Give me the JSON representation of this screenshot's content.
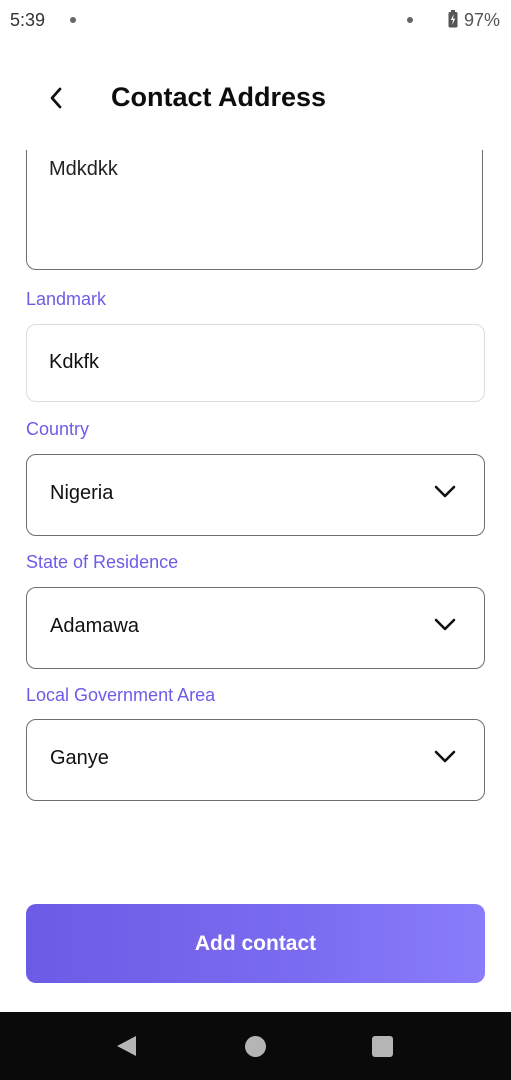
{
  "status_bar": {
    "time": "5:39",
    "battery": "97%"
  },
  "header": {
    "title": "Contact Address",
    "back_icon": "chevron-left-icon"
  },
  "form": {
    "address_value": "Mdkdkk",
    "landmark_label": "Landmark",
    "landmark_value": "Kdkfk",
    "country_label": "Country",
    "country_value": "Nigeria",
    "state_label": "State of Residence",
    "state_value": "Adamawa",
    "lga_label": "Local Government Area",
    "lga_value": "Ganye"
  },
  "actions": {
    "add_contact_label": "Add contact"
  },
  "colors": {
    "accent": "#6c5ce7",
    "button_start": "#6c5be6",
    "button_end": "#8a7dfa",
    "nav_bar": "#0a0a0a"
  }
}
